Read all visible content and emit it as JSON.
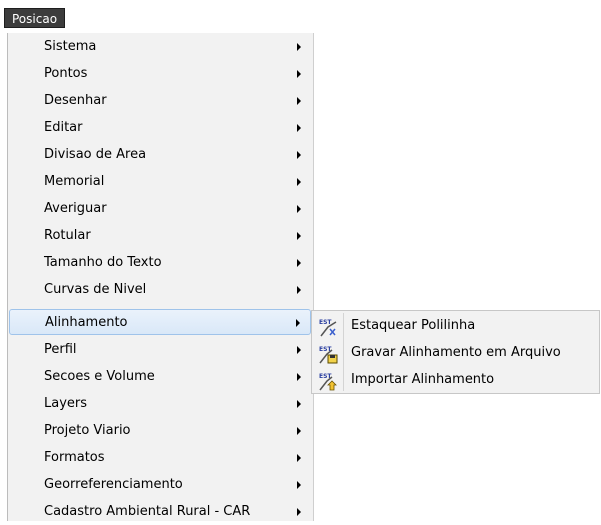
{
  "menubar": {
    "title": "Posicao"
  },
  "menu": {
    "items": [
      {
        "label": "Sistema"
      },
      {
        "label": "Pontos"
      },
      {
        "label": "Desenhar"
      },
      {
        "label": "Editar"
      },
      {
        "label": "Divisao de Area"
      },
      {
        "label": "Memorial"
      },
      {
        "label": "Averiguar"
      },
      {
        "label": "Rotular"
      },
      {
        "label": "Tamanho do Texto"
      },
      {
        "label": "Curvas de Nivel"
      },
      {
        "label": "Alinhamento"
      },
      {
        "label": "Perfil"
      },
      {
        "label": "Secoes e Volume"
      },
      {
        "label": "Layers"
      },
      {
        "label": "Projeto Viario"
      },
      {
        "label": "Formatos"
      },
      {
        "label": "Georreferenciamento"
      },
      {
        "label": "Cadastro Ambiental Rural - CAR"
      }
    ],
    "highlighted": "Alinhamento"
  },
  "submenu": {
    "items": [
      {
        "label": "Estaquear Polilinha",
        "icon": "est-stake-icon",
        "icon_text": "EST"
      },
      {
        "label": "Gravar Alinhamento em Arquivo",
        "icon": "est-save-icon",
        "icon_text": "EST"
      },
      {
        "label": "Importar Alinhamento",
        "icon": "est-import-icon",
        "icon_text": "EST"
      }
    ]
  },
  "colors": {
    "menubar_bg": "#3c3c3c",
    "menu_bg": "#f2f2f2",
    "highlight_border": "#9fc3ea",
    "icon_text": "#2a3fa0"
  }
}
